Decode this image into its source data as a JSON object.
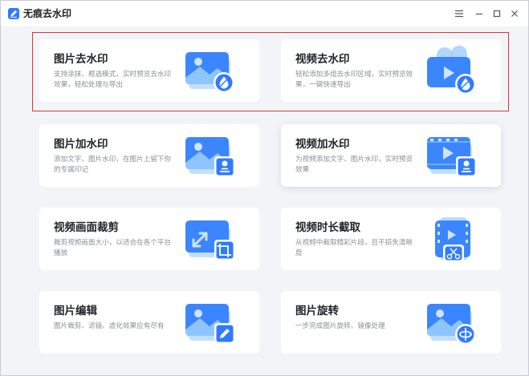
{
  "window": {
    "title": "无痕去水印",
    "controls": [
      "menu-icon",
      "minimize-icon",
      "maximize-icon",
      "close-icon"
    ]
  },
  "colors": {
    "accent": "#2f7bff",
    "accent_light": "#8ec5ff",
    "highlight": "#d63a3a"
  },
  "cards": [
    {
      "title": "图片去水印",
      "desc": "支持涂抹、框选模式，实时预览去水印效果，轻松处理与导出",
      "icon": "image-remove-watermark-icon"
    },
    {
      "title": "视频去水印",
      "desc": "轻松添加多组去水印区域，实时预览效果，一键快速导出",
      "icon": "video-remove-watermark-icon"
    },
    {
      "title": "图片加水印",
      "desc": "添加文字、图片水印，在图片上留下你的专属印记",
      "icon": "image-add-watermark-icon"
    },
    {
      "title": "视频加水印",
      "desc": "为视频添加文字、图片水印，实时预览效果",
      "icon": "video-add-watermark-icon"
    },
    {
      "title": "视频画面裁剪",
      "desc": "裁剪视频画面大小，以适合在各个平台播放",
      "icon": "video-crop-icon"
    },
    {
      "title": "视频时长截取",
      "desc": "从视频中截取精彩片段，且不损失清晰度",
      "icon": "video-trim-icon"
    },
    {
      "title": "图片编辑",
      "desc": "图片裁剪、滤镜、虚化效果应有尽有",
      "icon": "image-edit-icon"
    },
    {
      "title": "图片旋转",
      "desc": "一步完成图片旋转、镜像处理",
      "icon": "image-rotate-icon"
    }
  ]
}
